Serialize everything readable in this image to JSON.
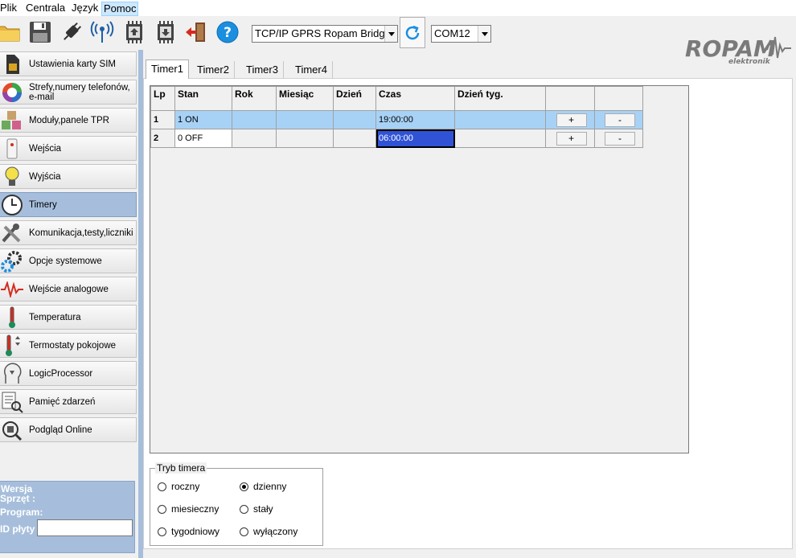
{
  "menu": {
    "items": [
      {
        "label": "Plik"
      },
      {
        "label": "Centrala"
      },
      {
        "label": "Język"
      },
      {
        "label": "Pomoc"
      }
    ]
  },
  "toolbar": {
    "connection_value": "TCP/IP GPRS Ropam Bridge",
    "port_value": "COM12"
  },
  "brand": {
    "logo_text": "ROPAM",
    "logo_subtext": "elektronik"
  },
  "sidebar": {
    "items": [
      {
        "label": "Ustawienia karty SIM",
        "icon": "sim-card-icon"
      },
      {
        "label": "Strefy,numery telefonów, e-mail",
        "icon": "pie-chart-icon"
      },
      {
        "label": "Moduły,panele TPR",
        "icon": "cubes-icon"
      },
      {
        "label": "Wejścia",
        "icon": "sensor-icon"
      },
      {
        "label": "Wyjścia",
        "icon": "lightbulb-icon"
      },
      {
        "label": "Timery",
        "icon": "clock-icon"
      },
      {
        "label": "Komunikacja,testy,liczniki",
        "icon": "tools-icon"
      },
      {
        "label": "Opcje systemowe",
        "icon": "gears-icon"
      },
      {
        "label": "Wejście analogowe",
        "icon": "waveform-icon"
      },
      {
        "label": "Temperatura",
        "icon": "thermometer-icon"
      },
      {
        "label": "Termostaty pokojowe",
        "icon": "thermostat-icon"
      },
      {
        "label": "LogicProcessor",
        "icon": "logic-head-icon"
      },
      {
        "label": "Pamięć zdarzeń",
        "icon": "event-log-icon"
      },
      {
        "label": "Podgląd Online",
        "icon": "online-view-icon"
      }
    ],
    "active": "Timery",
    "version": {
      "title": "Wersja",
      "hardware_label": "Sprzęt :",
      "program_label": "Program:",
      "board_id_label": "ID płyty",
      "board_id_value": ""
    }
  },
  "tabs": [
    {
      "label": "Timer1"
    },
    {
      "label": "Timer2"
    },
    {
      "label": "Timer3"
    },
    {
      "label": "Timer4"
    }
  ],
  "grid": {
    "columns": [
      "Lp",
      "Stan",
      "Rok",
      "Miesiąc",
      "Dzień",
      "Czas",
      "Dzień tyg.",
      "",
      ""
    ],
    "rows": [
      {
        "lp": "1",
        "stan": "1 ON",
        "rok": "",
        "miesiac": "",
        "dzien": "",
        "czas": "19:00:00",
        "dzien_tyg": "",
        "add": "+",
        "remove": "-"
      },
      {
        "lp": "2",
        "stan": "0 OFF",
        "rok": "",
        "miesiac": "",
        "dzien": "",
        "czas": "06:00:00",
        "dzien_tyg": "",
        "add": "+",
        "remove": "-"
      }
    ]
  },
  "timer_mode": {
    "title": "Tryb timera",
    "options": [
      {
        "label": "roczny",
        "selected": false
      },
      {
        "label": "dzienny",
        "selected": true
      },
      {
        "label": "miesieczny",
        "selected": false
      },
      {
        "label": "stały",
        "selected": false
      },
      {
        "label": "tygodniowy",
        "selected": false
      },
      {
        "label": "wyłączony",
        "selected": false
      }
    ]
  },
  "colors": {
    "sidebar_active": "#a6bedb",
    "row_selected": "#a7d2f6",
    "cell_focus": "#3053d6",
    "help_blue": "#1a8fe0",
    "logo": "#7a7a7a"
  }
}
